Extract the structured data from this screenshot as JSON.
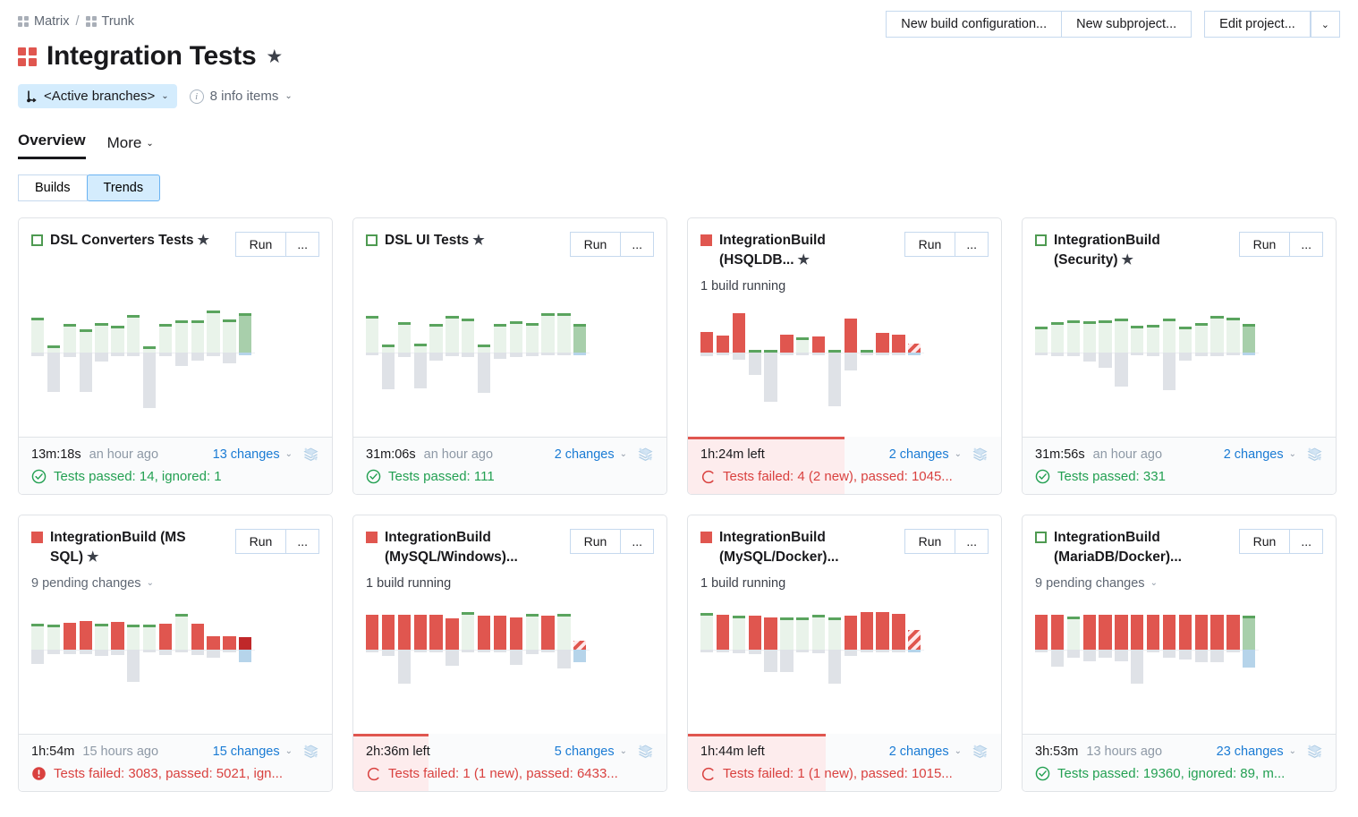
{
  "breadcrumb": {
    "root": "Matrix",
    "sep": "/",
    "child": "Trunk"
  },
  "header": {
    "title": "Integration Tests",
    "star": "★",
    "branch_label": "<Active branches>",
    "info_items": "8 info items",
    "caret": "⌄"
  },
  "actions": {
    "new_build_configuration": "New build configuration...",
    "new_subproject": "New subproject...",
    "edit_project": "Edit project...",
    "more_caret": "⌄"
  },
  "tabs": {
    "overview": "Overview",
    "more": "More",
    "caret": "⌄"
  },
  "segmented": {
    "builds": "Builds",
    "trends": "Trends",
    "active": "Trends"
  },
  "labels": {
    "run": "Run",
    "dots": "...",
    "caret": "⌄"
  },
  "colors": {
    "success_green": "#23a052",
    "bar_green_cap": "#5aa45e",
    "bar_green_fill": "#e9f3ea",
    "fail_red": "#e0564f",
    "fail_red_dark": "#c0282a",
    "text_red": "#d9413f",
    "grey_bar": "#dfe2e7",
    "blue_bar": "#b6d4ea",
    "link_blue": "#1a7bd4",
    "chip_blue": "#d4ecfd"
  },
  "cards": [
    {
      "status": "ok",
      "name": "DSL Converters Tests",
      "starred": true,
      "substatus": null,
      "footer": {
        "duration": "13m:18s",
        "ago": "an hour ago",
        "changes": "13 changes",
        "result": "Tests passed: 14, ignored: 1",
        "result_kind": "ok",
        "running": false,
        "progress_pct": 0
      },
      "chart_data": {
        "type": "bar",
        "title": "DSL Converters Tests build duration trend",
        "xlabel": "",
        "ylabel": "",
        "grid": false,
        "legend": "none",
        "up_color": "#e9f3ea",
        "cap_color": "#5aa45e",
        "down_color": "#dfe2e7",
        "bars": [
          {
            "up": 39,
            "down": 4,
            "state": "success"
          },
          {
            "up": 8,
            "down": 44,
            "state": "success"
          },
          {
            "up": 32,
            "down": 5,
            "state": "success"
          },
          {
            "up": 26,
            "down": 44,
            "state": "success"
          },
          {
            "up": 33,
            "down": 10,
            "state": "success"
          },
          {
            "up": 30,
            "down": 4,
            "state": "success"
          },
          {
            "up": 42,
            "down": 4,
            "state": "success"
          },
          {
            "up": 7,
            "down": 62,
            "state": "success"
          },
          {
            "up": 32,
            "down": 4,
            "state": "success"
          },
          {
            "up": 36,
            "down": 15,
            "state": "success"
          },
          {
            "up": 36,
            "down": 9,
            "state": "success"
          },
          {
            "up": 47,
            "down": 4,
            "state": "success"
          },
          {
            "up": 37,
            "down": 12,
            "state": "success"
          },
          {
            "up": 44,
            "down": 3,
            "state": "current-success"
          }
        ]
      }
    },
    {
      "status": "ok",
      "name": "DSL UI Tests",
      "starred": true,
      "substatus": null,
      "footer": {
        "duration": "31m:06s",
        "ago": "an hour ago",
        "changes": "2 changes",
        "result": "Tests passed: 111",
        "result_kind": "ok",
        "running": false,
        "progress_pct": 0
      },
      "chart_data": {
        "type": "bar",
        "title": "DSL UI Tests build duration trend",
        "xlabel": "",
        "ylabel": "",
        "grid": false,
        "legend": "none",
        "up_color": "#e9f3ea",
        "cap_color": "#5aa45e",
        "down_color": "#dfe2e7",
        "bars": [
          {
            "up": 41,
            "down": 3,
            "state": "success"
          },
          {
            "up": 9,
            "down": 41,
            "state": "success"
          },
          {
            "up": 34,
            "down": 5,
            "state": "success"
          },
          {
            "up": 10,
            "down": 40,
            "state": "success"
          },
          {
            "up": 32,
            "down": 9,
            "state": "success"
          },
          {
            "up": 41,
            "down": 4,
            "state": "success"
          },
          {
            "up": 38,
            "down": 5,
            "state": "success"
          },
          {
            "up": 9,
            "down": 45,
            "state": "success"
          },
          {
            "up": 32,
            "down": 7,
            "state": "success"
          },
          {
            "up": 35,
            "down": 5,
            "state": "success"
          },
          {
            "up": 33,
            "down": 4,
            "state": "success"
          },
          {
            "up": 44,
            "down": 3,
            "state": "success"
          },
          {
            "up": 44,
            "down": 3,
            "state": "success"
          },
          {
            "up": 32,
            "down": 3,
            "state": "current-success"
          }
        ]
      }
    },
    {
      "status": "fail",
      "name": "IntegrationBuild (HSQLDB...",
      "starred": true,
      "substatus": "1 build running",
      "footer": {
        "duration": "1h:24m left",
        "ago": null,
        "changes": "2 changes",
        "result": "Tests failed: 4 (2 new), passed: 1045...",
        "result_kind": "running",
        "running": true,
        "progress_pct": 50
      },
      "chart_data": {
        "type": "bar",
        "title": "IntegrationBuild (HSQLDB) build duration trend",
        "xlabel": "",
        "ylabel": "",
        "grid": false,
        "legend": "none",
        "up_color": "#e0564f",
        "cap_color": "#5aa45e",
        "down_color": "#dfe2e7",
        "bars": [
          {
            "up": 23,
            "down": 4,
            "state": "failure"
          },
          {
            "up": 19,
            "down": 3,
            "state": "failure"
          },
          {
            "up": 44,
            "down": 8,
            "state": "failure"
          },
          {
            "up": 3,
            "down": 25,
            "state": "success"
          },
          {
            "up": 3,
            "down": 55,
            "state": "success"
          },
          {
            "up": 20,
            "down": 3,
            "state": "failure"
          },
          {
            "up": 17,
            "down": 3,
            "state": "success"
          },
          {
            "up": 18,
            "down": 3,
            "state": "failure"
          },
          {
            "up": 3,
            "down": 60,
            "state": "success"
          },
          {
            "up": 38,
            "down": 20,
            "state": "failure"
          },
          {
            "up": 3,
            "down": 3,
            "state": "success"
          },
          {
            "up": 22,
            "down": 3,
            "state": "failure"
          },
          {
            "up": 20,
            "down": 3,
            "state": "failure"
          },
          {
            "up": 10,
            "down": 3,
            "state": "running-failure"
          }
        ]
      }
    },
    {
      "status": "ok",
      "name": "IntegrationBuild (Security)",
      "starred": true,
      "substatus": null,
      "footer": {
        "duration": "31m:56s",
        "ago": "an hour ago",
        "changes": "2 changes",
        "result": "Tests passed: 331",
        "result_kind": "ok",
        "running": false,
        "progress_pct": 0
      },
      "chart_data": {
        "type": "bar",
        "title": "IntegrationBuild (Security) build duration trend",
        "xlabel": "",
        "ylabel": "",
        "grid": false,
        "legend": "none",
        "up_color": "#e9f3ea",
        "cap_color": "#5aa45e",
        "down_color": "#dfe2e7",
        "bars": [
          {
            "up": 29,
            "down": 3,
            "state": "success"
          },
          {
            "up": 34,
            "down": 4,
            "state": "success"
          },
          {
            "up": 36,
            "down": 4,
            "state": "success"
          },
          {
            "up": 35,
            "down": 10,
            "state": "success"
          },
          {
            "up": 36,
            "down": 17,
            "state": "success"
          },
          {
            "up": 38,
            "down": 38,
            "state": "success"
          },
          {
            "up": 30,
            "down": 3,
            "state": "success"
          },
          {
            "up": 31,
            "down": 4,
            "state": "success"
          },
          {
            "up": 38,
            "down": 42,
            "state": "success"
          },
          {
            "up": 29,
            "down": 9,
            "state": "success"
          },
          {
            "up": 33,
            "down": 4,
            "state": "success"
          },
          {
            "up": 41,
            "down": 4,
            "state": "success"
          },
          {
            "up": 39,
            "down": 3,
            "state": "success"
          },
          {
            "up": 32,
            "down": 3,
            "state": "current-success"
          }
        ]
      }
    },
    {
      "status": "fail",
      "name": "IntegrationBuild (MS SQL)",
      "starred": true,
      "substatus": "9 pending changes",
      "substatus_kind": "pending",
      "footer": {
        "duration": "1h:54m",
        "ago": "15 hours ago",
        "changes": "15 changes",
        "result": "Tests failed: 3083, passed: 5021, ign...",
        "result_kind": "fail",
        "running": false,
        "progress_pct": 0
      },
      "chart_data": {
        "type": "bar",
        "title": "IntegrationBuild (MS SQL) build duration trend",
        "xlabel": "",
        "ylabel": "",
        "grid": false,
        "legend": "none",
        "up_color": "#e0564f",
        "cap_color": "#5aa45e",
        "down_color": "#dfe2e7",
        "bars": [
          {
            "up": 29,
            "down": 16,
            "state": "success"
          },
          {
            "up": 28,
            "down": 5,
            "state": "success"
          },
          {
            "up": 30,
            "down": 5,
            "state": "failure"
          },
          {
            "up": 32,
            "down": 5,
            "state": "failure"
          },
          {
            "up": 29,
            "down": 7,
            "state": "success"
          },
          {
            "up": 31,
            "down": 6,
            "state": "failure"
          },
          {
            "up": 28,
            "down": 36,
            "state": "success"
          },
          {
            "up": 28,
            "down": 3,
            "state": "success"
          },
          {
            "up": 29,
            "down": 6,
            "state": "failure"
          },
          {
            "up": 40,
            "down": 3,
            "state": "success"
          },
          {
            "up": 29,
            "down": 6,
            "state": "failure"
          },
          {
            "up": 15,
            "down": 9,
            "state": "failure"
          },
          {
            "up": 15,
            "down": 3,
            "state": "failure"
          },
          {
            "up": 14,
            "down": 14,
            "state": "current-failure"
          }
        ]
      }
    },
    {
      "status": "fail",
      "name": "IntegrationBuild (MySQL/Windows)...",
      "starred": false,
      "substatus": "1 build running",
      "footer": {
        "duration": "2h:36m left",
        "ago": null,
        "changes": "5 changes",
        "result": "Tests failed: 1 (1 new), passed: 6433...",
        "result_kind": "running",
        "running": true,
        "progress_pct": 24
      },
      "chart_data": {
        "type": "bar",
        "title": "IntegrationBuild (MySQL/Windows) build duration trend",
        "xlabel": "",
        "ylabel": "",
        "grid": false,
        "legend": "none",
        "up_color": "#e0564f",
        "cap_color": "#5aa45e",
        "down_color": "#dfe2e7",
        "bars": [
          {
            "up": 39,
            "down": 3,
            "state": "failure"
          },
          {
            "up": 39,
            "down": 7,
            "state": "failure"
          },
          {
            "up": 39,
            "down": 38,
            "state": "failure"
          },
          {
            "up": 39,
            "down": 3,
            "state": "failure"
          },
          {
            "up": 39,
            "down": 3,
            "state": "failure"
          },
          {
            "up": 35,
            "down": 18,
            "state": "failure"
          },
          {
            "up": 42,
            "down": 3,
            "state": "success"
          },
          {
            "up": 38,
            "down": 3,
            "state": "failure"
          },
          {
            "up": 38,
            "down": 3,
            "state": "failure"
          },
          {
            "up": 36,
            "down": 17,
            "state": "failure"
          },
          {
            "up": 40,
            "down": 5,
            "state": "success"
          },
          {
            "up": 38,
            "down": 3,
            "state": "failure"
          },
          {
            "up": 40,
            "down": 21,
            "state": "success"
          },
          {
            "up": 10,
            "down": 14,
            "state": "running-failure"
          }
        ]
      }
    },
    {
      "status": "fail",
      "name": "IntegrationBuild (MySQL/Docker)...",
      "starred": false,
      "substatus": "1 build running",
      "footer": {
        "duration": "1h:44m left",
        "ago": null,
        "changes": "2 changes",
        "result": "Tests failed: 1 (1 new), passed: 1015...",
        "result_kind": "running",
        "running": true,
        "progress_pct": 44
      },
      "chart_data": {
        "type": "bar",
        "title": "IntegrationBuild (MySQL/Docker) build duration trend",
        "xlabel": "",
        "ylabel": "",
        "grid": false,
        "legend": "none",
        "up_color": "#e0564f",
        "cap_color": "#5aa45e",
        "down_color": "#dfe2e7",
        "bars": [
          {
            "up": 41,
            "down": 3,
            "state": "success"
          },
          {
            "up": 39,
            "down": 3,
            "state": "failure"
          },
          {
            "up": 38,
            "down": 4,
            "state": "success"
          },
          {
            "up": 38,
            "down": 5,
            "state": "failure"
          },
          {
            "up": 36,
            "down": 25,
            "state": "failure"
          },
          {
            "up": 36,
            "down": 25,
            "state": "success"
          },
          {
            "up": 36,
            "down": 3,
            "state": "success"
          },
          {
            "up": 39,
            "down": 4,
            "state": "success"
          },
          {
            "up": 36,
            "down": 38,
            "state": "success"
          },
          {
            "up": 38,
            "down": 7,
            "state": "failure"
          },
          {
            "up": 42,
            "down": 3,
            "state": "failure"
          },
          {
            "up": 42,
            "down": 3,
            "state": "failure"
          },
          {
            "up": 40,
            "down": 3,
            "state": "failure"
          },
          {
            "up": 22,
            "down": 3,
            "state": "running-failure"
          }
        ]
      }
    },
    {
      "status": "ok",
      "name": "IntegrationBuild (MariaDB/Docker)...",
      "starred": false,
      "substatus": "9 pending changes",
      "substatus_kind": "pending",
      "footer": {
        "duration": "3h:53m",
        "ago": "13 hours ago",
        "changes": "23 changes",
        "result": "Tests passed: 19360, ignored: 89, m...",
        "result_kind": "ok",
        "running": false,
        "progress_pct": 0
      },
      "chart_data": {
        "type": "bar",
        "title": "IntegrationBuild (MariaDB/Docker) build duration trend",
        "xlabel": "",
        "ylabel": "",
        "grid": false,
        "legend": "none",
        "up_color": "#e0564f",
        "cap_color": "#5aa45e",
        "down_color": "#dfe2e7",
        "bars": [
          {
            "up": 39,
            "down": 3,
            "state": "failure"
          },
          {
            "up": 39,
            "down": 19,
            "state": "failure"
          },
          {
            "up": 37,
            "down": 9,
            "state": "success"
          },
          {
            "up": 39,
            "down": 13,
            "state": "failure"
          },
          {
            "up": 39,
            "down": 9,
            "state": "failure"
          },
          {
            "up": 39,
            "down": 13,
            "state": "failure"
          },
          {
            "up": 39,
            "down": 38,
            "state": "failure"
          },
          {
            "up": 39,
            "down": 3,
            "state": "failure"
          },
          {
            "up": 39,
            "down": 9,
            "state": "failure"
          },
          {
            "up": 39,
            "down": 11,
            "state": "failure"
          },
          {
            "up": 39,
            "down": 14,
            "state": "failure"
          },
          {
            "up": 39,
            "down": 14,
            "state": "failure"
          },
          {
            "up": 39,
            "down": 3,
            "state": "failure"
          },
          {
            "up": 38,
            "down": 20,
            "state": "current-success"
          }
        ]
      }
    }
  ]
}
